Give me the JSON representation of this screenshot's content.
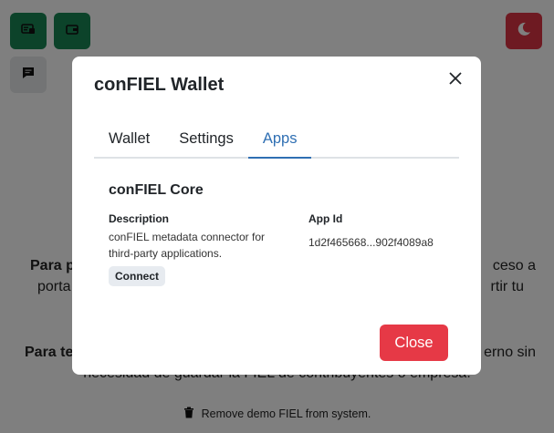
{
  "background": {
    "toolbar": {
      "wallet_icon": "wallet-card-icon",
      "folder_icon": "wallet-icon",
      "chat_icon": "chat-icon",
      "theme_icon": "moon-icon"
    },
    "paragraph1_bold": "Para p",
    "paragraph1_line1_end": "ceso a",
    "paragraph1_line2_start": "porta",
    "paragraph1_line2_end": "rtir tu",
    "paragraph2_bold": "Para te",
    "paragraph2_line1_end": "erno sin",
    "paragraph2_line2": "necesidad de guardar la FIEL de contribuyentes o empresa.",
    "remove_demo": "Remove demo FIEL from system."
  },
  "modal": {
    "title": "conFIEL Wallet",
    "tabs": [
      {
        "label": "Wallet"
      },
      {
        "label": "Settings"
      },
      {
        "label": "Apps"
      }
    ],
    "app": {
      "name": "conFIEL Core",
      "description_label": "Description",
      "description": "conFIEL metadata connector for third-party applications.",
      "app_id_label": "App Id",
      "app_id": "1d2f465668...902f4089a8",
      "connect_label": "Connect"
    },
    "close_label": "Close"
  },
  "colors": {
    "green": "#198754",
    "red": "#dc3545",
    "tab_active": "#2f6fb3",
    "close_button": "#e63946"
  }
}
